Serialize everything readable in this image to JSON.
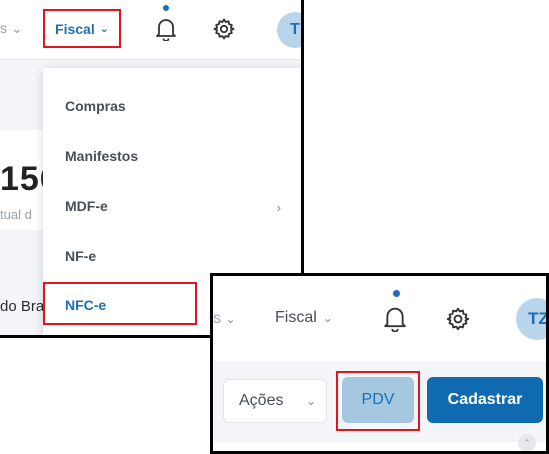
{
  "top_panel": {
    "header": {
      "prev_menu_partial": "s",
      "fiscal_label": "Fiscal",
      "avatar_initials": "T"
    },
    "background": {
      "big_number_partial": "156",
      "subtext_partial": "tual d",
      "bottom_text_partial": "do Bra"
    },
    "fiscal_dropdown": {
      "items": [
        {
          "label": "Compras"
        },
        {
          "label": "Manifestos"
        },
        {
          "label": "MDF-e",
          "has_submenu": true
        },
        {
          "label": "NF-e"
        },
        {
          "label": "NFC-e",
          "highlighted": true
        }
      ]
    }
  },
  "bottom_panel": {
    "header": {
      "prev_menu_partial": "s",
      "fiscal_label": "Fiscal",
      "avatar_initials": "TZ"
    },
    "toolbar": {
      "acoes_label": "Ações",
      "pdv_label": "PDV",
      "cadastrar_label": "Cadastrar"
    }
  },
  "colors": {
    "highlight_border": "#e0161d",
    "primary": "#0f6ab0",
    "link_blue": "#1c6fb5",
    "pdv_bg": "#a6c7e0"
  }
}
